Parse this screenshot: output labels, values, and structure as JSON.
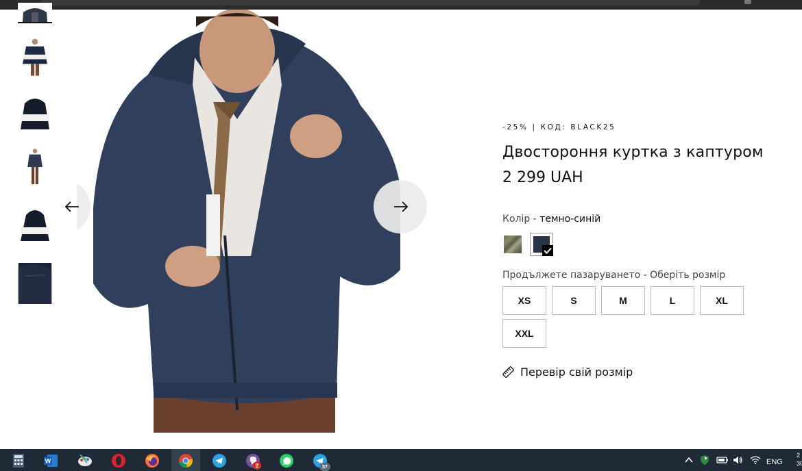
{
  "product": {
    "promo": "-25% | КОД: BLACK25",
    "title": "Двостороння куртка з каптуром",
    "price": "2 299 UAH",
    "color_label": "Колір - ",
    "color_value": "темно-синій",
    "size_prompt": "Продължете пазаруването - Оберіть розмір",
    "sizes": [
      "XS",
      "S",
      "M",
      "L",
      "XL",
      "XXL"
    ],
    "size_check_label": "Перевір свій розмір"
  },
  "swatches": [
    {
      "name": "camo",
      "color": "#6f735c"
    },
    {
      "name": "navy",
      "color": "#2a3448",
      "selected": true
    }
  ],
  "icons": {
    "prev": "arrow-left-icon",
    "next": "arrow-right-icon",
    "ruler": "ruler-icon"
  },
  "taskbar": {
    "apps": [
      "calculator",
      "word",
      "paint",
      "opera",
      "firefox",
      "chrome",
      "telegram",
      "viber",
      "whatsapp",
      "telegram-2"
    ],
    "viber_badge": "2",
    "telegram_badge": "57",
    "lang": "ENG",
    "clock_partial": "2",
    "date_partial": "30"
  },
  "colors": {
    "accent": "#111111",
    "taskbar": "#1f2a36"
  }
}
